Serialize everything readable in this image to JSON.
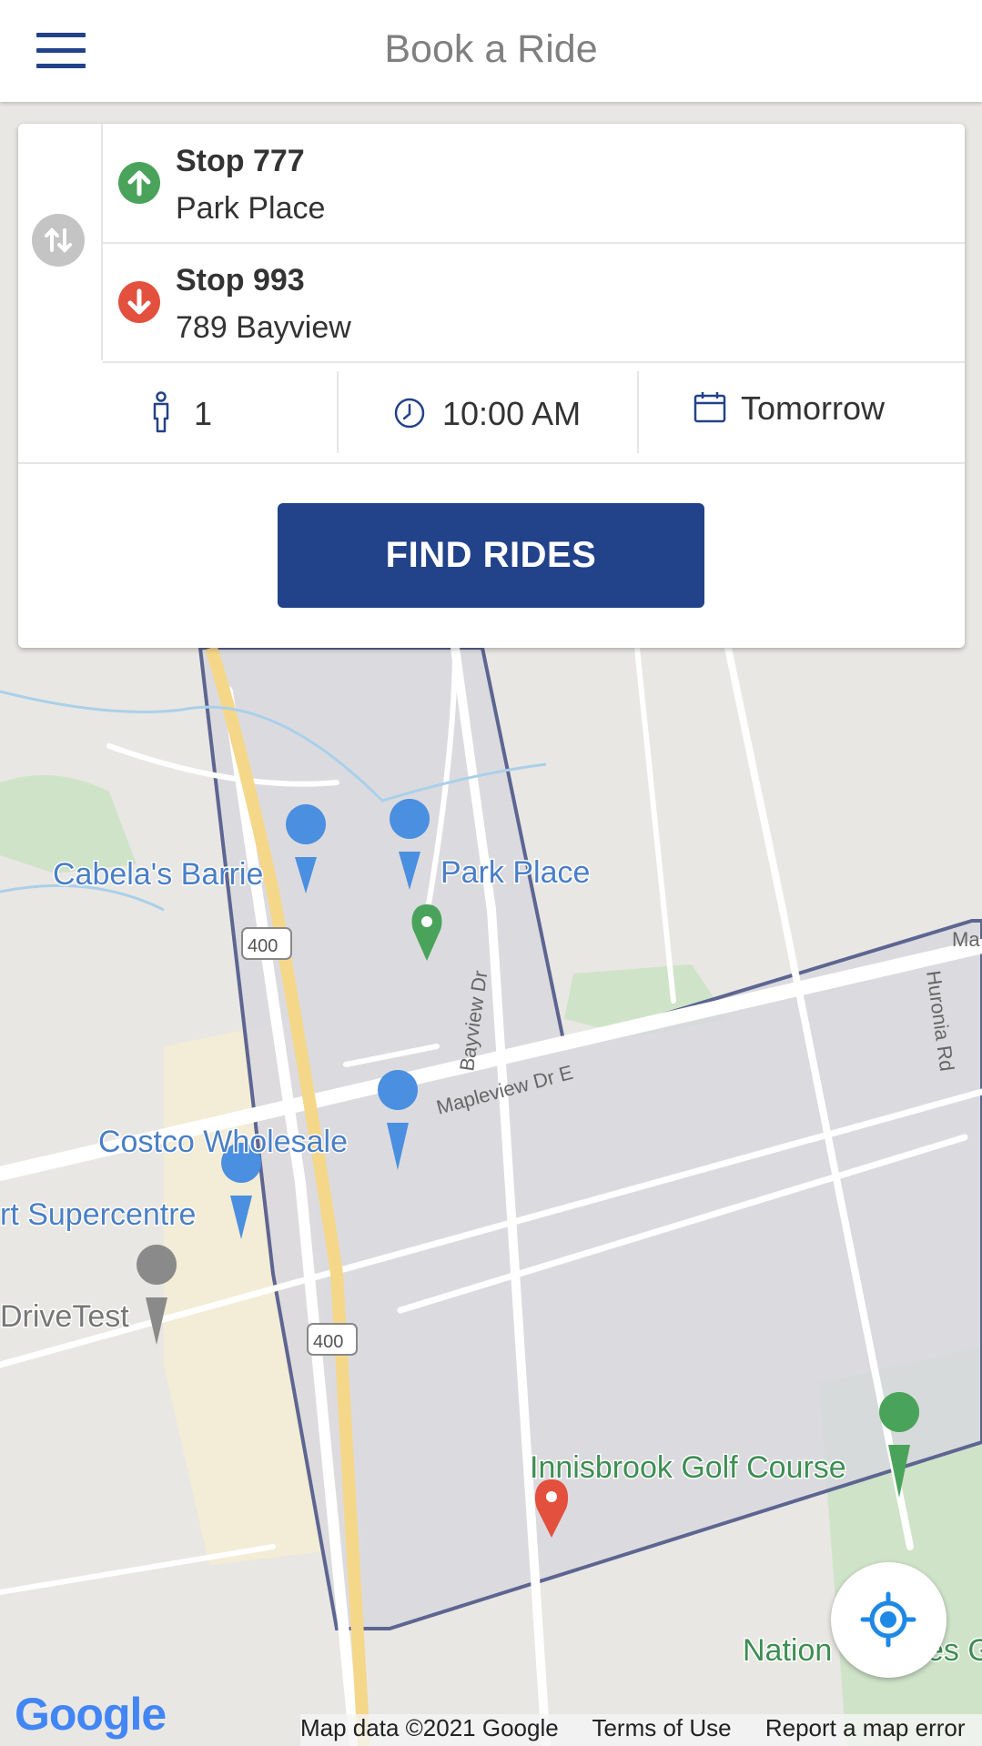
{
  "header": {
    "title": "Book a Ride"
  },
  "trip": {
    "pickup": {
      "name": "Stop 777",
      "address": "Park Place"
    },
    "dropoff": {
      "name": "Stop 993",
      "address": "789 Bayview"
    }
  },
  "options": {
    "passengers": "1",
    "time": "10:00 AM",
    "date": "Tomorrow"
  },
  "actions": {
    "find_rides": "FIND RIDES"
  },
  "map": {
    "places": {
      "cabelas": "Cabela's Barrie",
      "park_place": "Park Place",
      "costco": "Costco Wholesale",
      "supercentre": "rt Supercentre",
      "drivetest": "DriveTest",
      "innisbrook": "Innisbrook Golf Course",
      "national": "Nation",
      "national_end": "es G"
    },
    "roads": {
      "bayview": "Bayview Dr",
      "mapleview": "Mapleview Dr E",
      "huronia": "Huronia Rd",
      "highway_a": "400",
      "highway_b": "400",
      "ma": "Ma"
    },
    "attribution": {
      "map_data": "Map data ©2021 Google",
      "terms": "Terms of Use",
      "report": "Report a map error"
    },
    "logo": "Google"
  },
  "colors": {
    "brand": "#22428a",
    "pickup": "#4aa35a",
    "dropoff": "#e3503d",
    "accent": "#1e88e5"
  }
}
